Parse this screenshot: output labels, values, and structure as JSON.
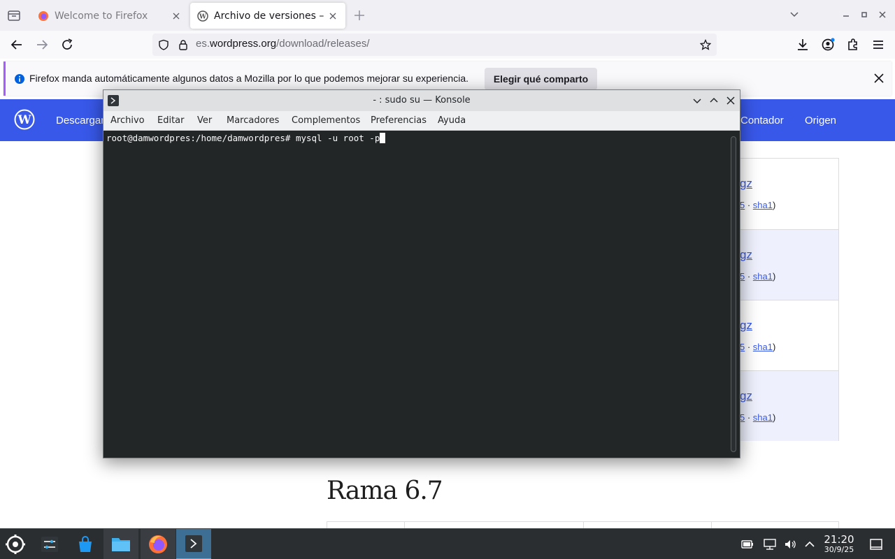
{
  "browser": {
    "tabs": [
      {
        "title": "Welcome to Firefox",
        "favicon": "firefox-icon",
        "active": false
      },
      {
        "title": "Archivo de versiones – WordPress",
        "favicon": "wordpress-icon",
        "active": true
      }
    ],
    "url": {
      "prefix": "es.",
      "host": "wordpress.org",
      "path": "/download/releases/"
    },
    "toolbar_icons": [
      "back-icon",
      "forward-icon",
      "reload-icon",
      "shield-icon",
      "lock-icon",
      "bookmark-star-icon",
      "downloads-icon",
      "account-icon",
      "extensions-icon",
      "menu-icon"
    ]
  },
  "notification": {
    "message": "Firefox manda automáticamente algunos datos a Mozilla por lo que podemos mejorar su experiencia.",
    "button_label": "Elegir qué comparto"
  },
  "wordpress": {
    "nav_left": "Descargar",
    "nav_right": [
      "Contador",
      "Origen"
    ],
    "release_rows": [
      {
        "file_fragment": "gz",
        "md5_fragment": "5",
        "sha1": "sha1"
      },
      {
        "file_fragment": "gz",
        "md5_fragment": "5",
        "sha1": "sha1"
      },
      {
        "file_fragment": "gz",
        "md5_fragment": "5",
        "sha1": "sha1"
      },
      {
        "file_fragment": "gz",
        "md5_fragment": "5",
        "sha1": "sha1"
      }
    ],
    "section_heading": "Rama 6.7"
  },
  "konsole": {
    "title": "- : sudo su — Konsole",
    "menu": [
      "Archivo",
      "Editar",
      "Ver",
      "Marcadores",
      "Complementos",
      "Preferencias",
      "Ayuda"
    ],
    "prompt": "root@damwordpres:/home/damwordpres#",
    "command": "mysql -u root -p"
  },
  "taskbar": {
    "apps": [
      "kde-launcher-icon",
      "system-settings-icon",
      "discover-store-icon",
      "file-manager-icon",
      "firefox-icon",
      "konsole-icon"
    ],
    "time": "21:20",
    "date": "30/9/25"
  },
  "colors": {
    "wp_blue": "#3858e9",
    "terminal_bg": "#232627",
    "taskbar_bg": "#2b2e31",
    "accent": "#3daee9"
  }
}
